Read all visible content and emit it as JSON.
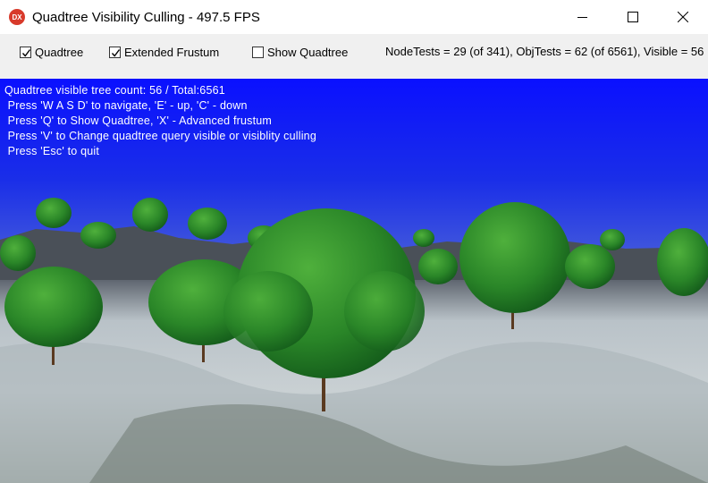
{
  "window": {
    "title": "Quadtree Visibility Culling - 497.5 FPS",
    "icon_text": "DX"
  },
  "toolbar": {
    "checkboxes": [
      {
        "label": "Quadtree",
        "checked": true
      },
      {
        "label": "Extended Frustum",
        "checked": true
      },
      {
        "label": "Show Quadtree",
        "checked": false
      }
    ],
    "stats": "NodeTests = 29 (of 341), ObjTests = 62 (of 6561), Visible = 56"
  },
  "overlay": {
    "lines": [
      "Quadtree visible tree count: 56 / Total:6561",
      " Press 'W A S D' to navigate, 'E' - up, 'C' - down",
      " Press 'Q' to Show Quadtree, 'X' - Advanced frustum",
      " Press 'V' to Change quadtree query visible or visiblity culling",
      " Press 'Esc' to quit"
    ]
  },
  "colors": {
    "sky_top": "#0a14ff",
    "sky_horizon": "#8fa4d8",
    "terrain": "#b8c0c8",
    "tree_foliage": "#2e8a2a"
  }
}
